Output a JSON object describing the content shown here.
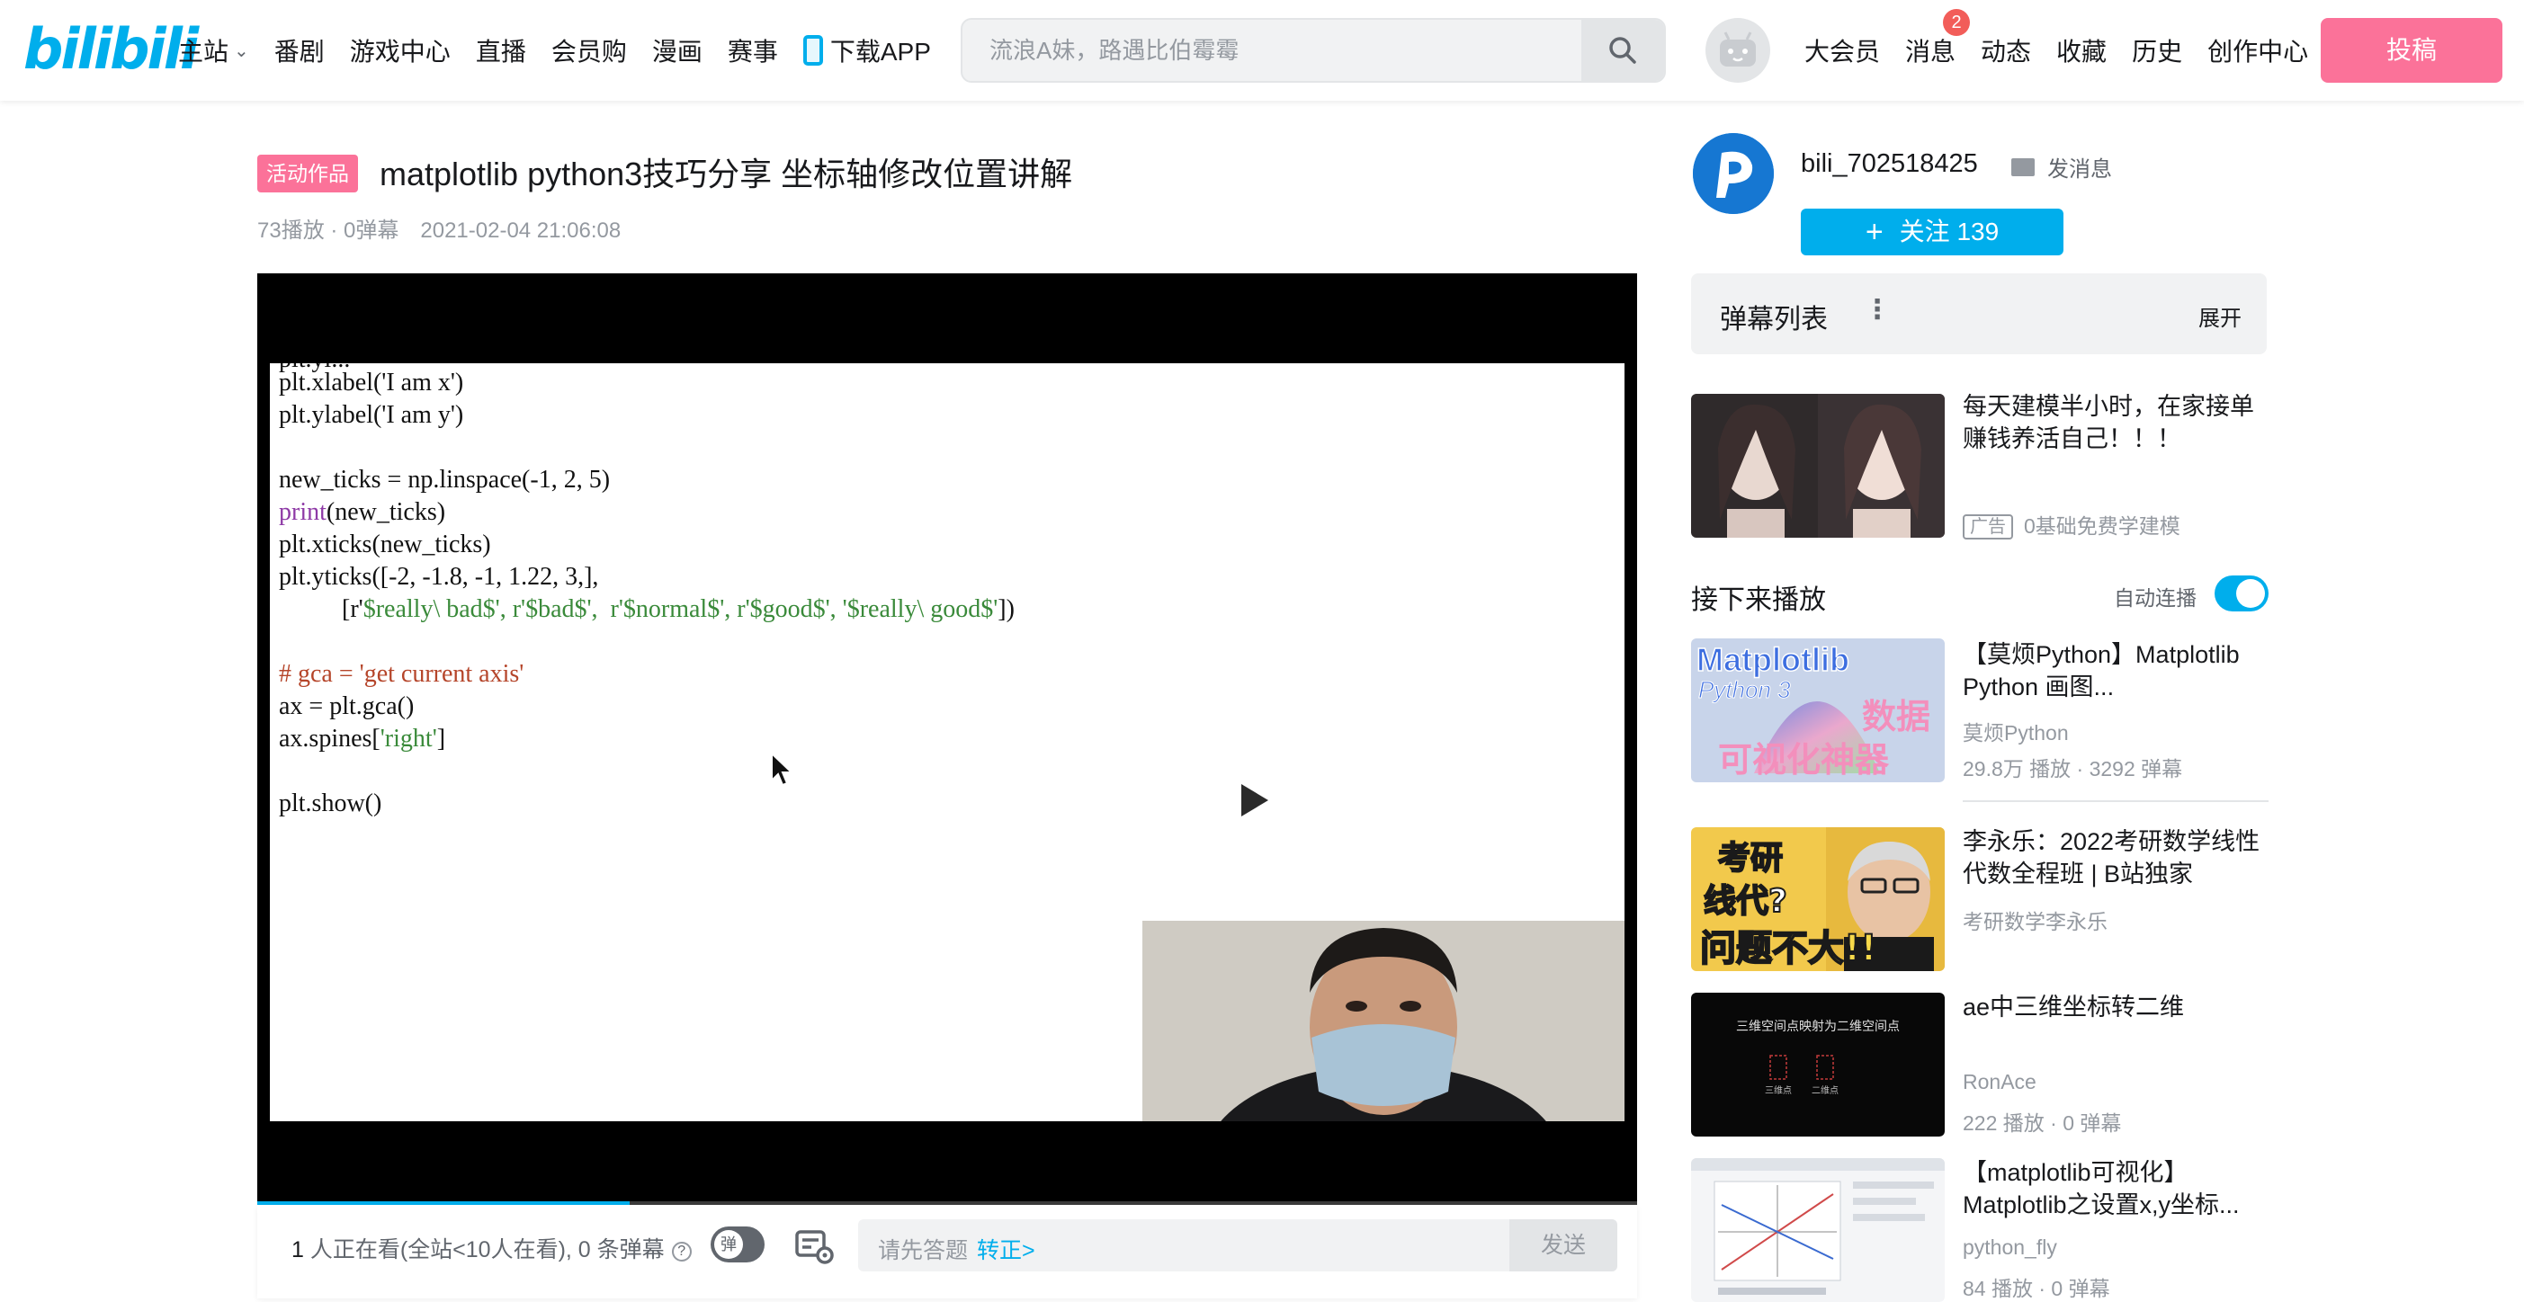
{
  "header": {
    "logo": "bilibili",
    "nav": [
      {
        "label": "主站",
        "has_chevron": true
      },
      {
        "label": "番剧"
      },
      {
        "label": "游戏中心"
      },
      {
        "label": "直播"
      },
      {
        "label": "会员购"
      },
      {
        "label": "漫画"
      },
      {
        "label": "赛事"
      },
      {
        "label": "下载APP",
        "icon": "phone-icon"
      }
    ],
    "search_placeholder": "流浪A妹，路遇比伯霉霉",
    "right_nav": [
      {
        "label": "大会员"
      },
      {
        "label": "消息",
        "badge": "2"
      },
      {
        "label": "动态"
      },
      {
        "label": "收藏"
      },
      {
        "label": "历史"
      },
      {
        "label": "创作中心"
      }
    ],
    "upload_label": "投稿",
    "accent": "#00aeec",
    "upload_color": "#fb7299"
  },
  "video": {
    "tag": "活动作品",
    "title": "matplotlib python3技巧分享 坐标轴修改位置讲解",
    "stats": "73播放 · 0弹幕",
    "date": "2021-02-04 21:06:08",
    "progress": 0.27
  },
  "slide_code": {
    "l1": "plt.xlabel('I am x')",
    "l2": "plt.ylabel('I am y')",
    "l3": "new_ticks = np.linspace(-1, 2, 5)",
    "l4_kw": "print",
    "l4": "(new_ticks)",
    "l5": "plt.xticks(new_ticks)",
    "l6": "plt.yticks([-2, -1.8, -1, 1.22, 3,],",
    "l7_a": "          [r'",
    "l7_b": "$really\\ bad$', r'$bad$',  r'$normal$', r'$good$', '$really\\ good$'",
    "l7_c": "])",
    "l8": "# gca = 'get current axis'",
    "l9": "ax = plt.gca()",
    "l10_a": "ax.spines[",
    "l10_b": "'right'",
    "l10_c": "]",
    "l11": "plt.show()"
  },
  "danmaku_bar": {
    "viewers_count": "1",
    "viewers_text": " 人正在看(全站<10人在看), 0 条弹幕",
    "toggle_label": "弹",
    "input_placeholder": "请先答题",
    "input_link": "转正>",
    "send_label": "发送"
  },
  "uploader": {
    "name": "bili_702518425",
    "message_label": "发消息",
    "follow_label": "关注 139"
  },
  "danmaku_list": {
    "title": "弹幕列表",
    "expand_label": "展开"
  },
  "ad": {
    "title": "每天建模半小时，在家接单赚钱养活自己！！！",
    "ad_tag": "广告",
    "sub": "0基础免费学建模"
  },
  "next_up": {
    "title": "接下来播放",
    "autoplay_label": "自动连播",
    "autoplay_on": true
  },
  "recommendations": [
    {
      "title": "【莫烦Python】Matplotlib Python 画图...",
      "author": "莫烦Python",
      "stats": "29.8万 播放 · 3292 弹幕",
      "thumb_text_1": "Matplotlib",
      "thumb_text_2": "Python 3",
      "thumb_text_3": "数据",
      "thumb_text_4": "可视化神器"
    },
    {
      "title": "李永乐：2022考研数学线性代数全程班 | B站独家",
      "author": "考研数学李永乐",
      "stats": "",
      "thumb_text_1": "考研",
      "thumb_text_2": "线代?",
      "thumb_text_3": "问题不大!!"
    },
    {
      "title": "ae中三维坐标转二维",
      "author": "RonAce",
      "stats": "222 播放 · 0 弹幕",
      "thumb_text_1": "三维空间点映射为二维空间点",
      "thumb_text_2": "三维点",
      "thumb_text_3": "二维点"
    },
    {
      "title": "【matplotlib可视化】Matplotlib之设置x,y坐标...",
      "author": "python_fly",
      "stats": "84 播放 · 0 弹幕"
    }
  ]
}
